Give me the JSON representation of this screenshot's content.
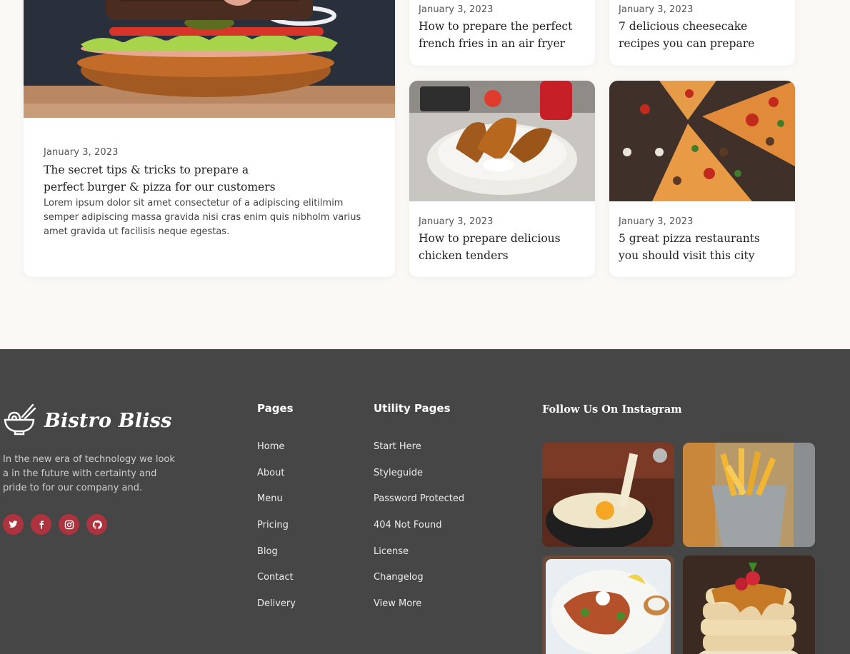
{
  "blog": {
    "featured": {
      "date": "January 3, 2023",
      "title_line1": "The secret tips & tricks to prepare a",
      "title_line2": "perfect burger & pizza for our customers",
      "excerpt": "Lorem ipsum dolor sit amet consectetur of a adipiscing elitilmim semper adipiscing massa gravida nisi cras enim quis nibholm varius amet gravida ut facilisis neque egestas."
    },
    "posts": [
      {
        "date": "January 3, 2023",
        "title_line1": "How to prepare the perfect",
        "title_line2": "french fries in an air fryer"
      },
      {
        "date": "January 3, 2023",
        "title_line1": "7 delicious cheesecake",
        "title_line2": "recipes you can prepare"
      },
      {
        "date": "January 3, 2023",
        "title_line1": "How to prepare delicious",
        "title_line2": "chicken tenders"
      },
      {
        "date": "January 3, 2023",
        "title_line1": "5 great pizza restaurants",
        "title_line2": "you should visit this city"
      }
    ]
  },
  "footer": {
    "brand": "Bistro Bliss",
    "description": "In the new era of technology we look a in the future with certainty and pride to for our company and.",
    "socials": [
      "twitter-icon",
      "facebook-icon",
      "instagram-icon",
      "github-icon"
    ],
    "pages_title": "Pages",
    "pages": [
      "Home",
      "About",
      "Menu",
      "Pricing",
      "Blog",
      "Contact",
      "Delivery"
    ],
    "utility_title": "Utility Pages",
    "utility": [
      "Start Here",
      "Styleguide",
      "Password Protected",
      "404 Not Found",
      "License",
      "Changelog",
      "View More"
    ],
    "instagram_title": "Follow Us On Instagram"
  },
  "colors": {
    "accent": "#ad343e",
    "footer_bg": "#464646",
    "page_bg": "#fbf9f6"
  }
}
